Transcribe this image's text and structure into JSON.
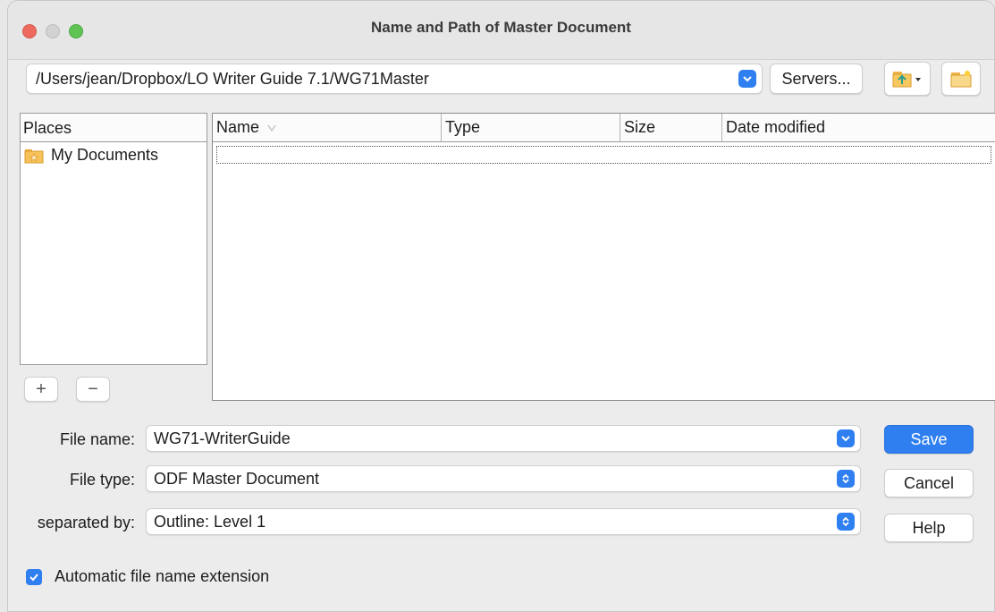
{
  "window": {
    "title": "Name and Path of Master Document"
  },
  "path": {
    "value": "/Users/jean/Dropbox/LO Writer Guide 7.1/WG71Master"
  },
  "toolbar": {
    "servers_label": "Servers..."
  },
  "places": {
    "header": "Places",
    "items": [
      {
        "label": "My Documents"
      }
    ],
    "add_label": "+",
    "remove_label": "−"
  },
  "files": {
    "columns": [
      "Name",
      "Type",
      "Size",
      "Date modified"
    ],
    "rows": []
  },
  "form": {
    "file_name_label": "File name:",
    "file_name_value": "WG71-WriterGuide",
    "file_type_label": "File type:",
    "file_type_value": "ODF Master Document",
    "separated_by_label": "separated by:",
    "separated_by_value": "Outline: Level 1"
  },
  "buttons": {
    "save": "Save",
    "cancel": "Cancel",
    "help": "Help"
  },
  "auto_ext": {
    "label": "Automatic file name extension",
    "checked": true
  },
  "colors": {
    "accent": "#2f7ff1",
    "close": "#ee6a5e",
    "maximize": "#5fc454"
  }
}
